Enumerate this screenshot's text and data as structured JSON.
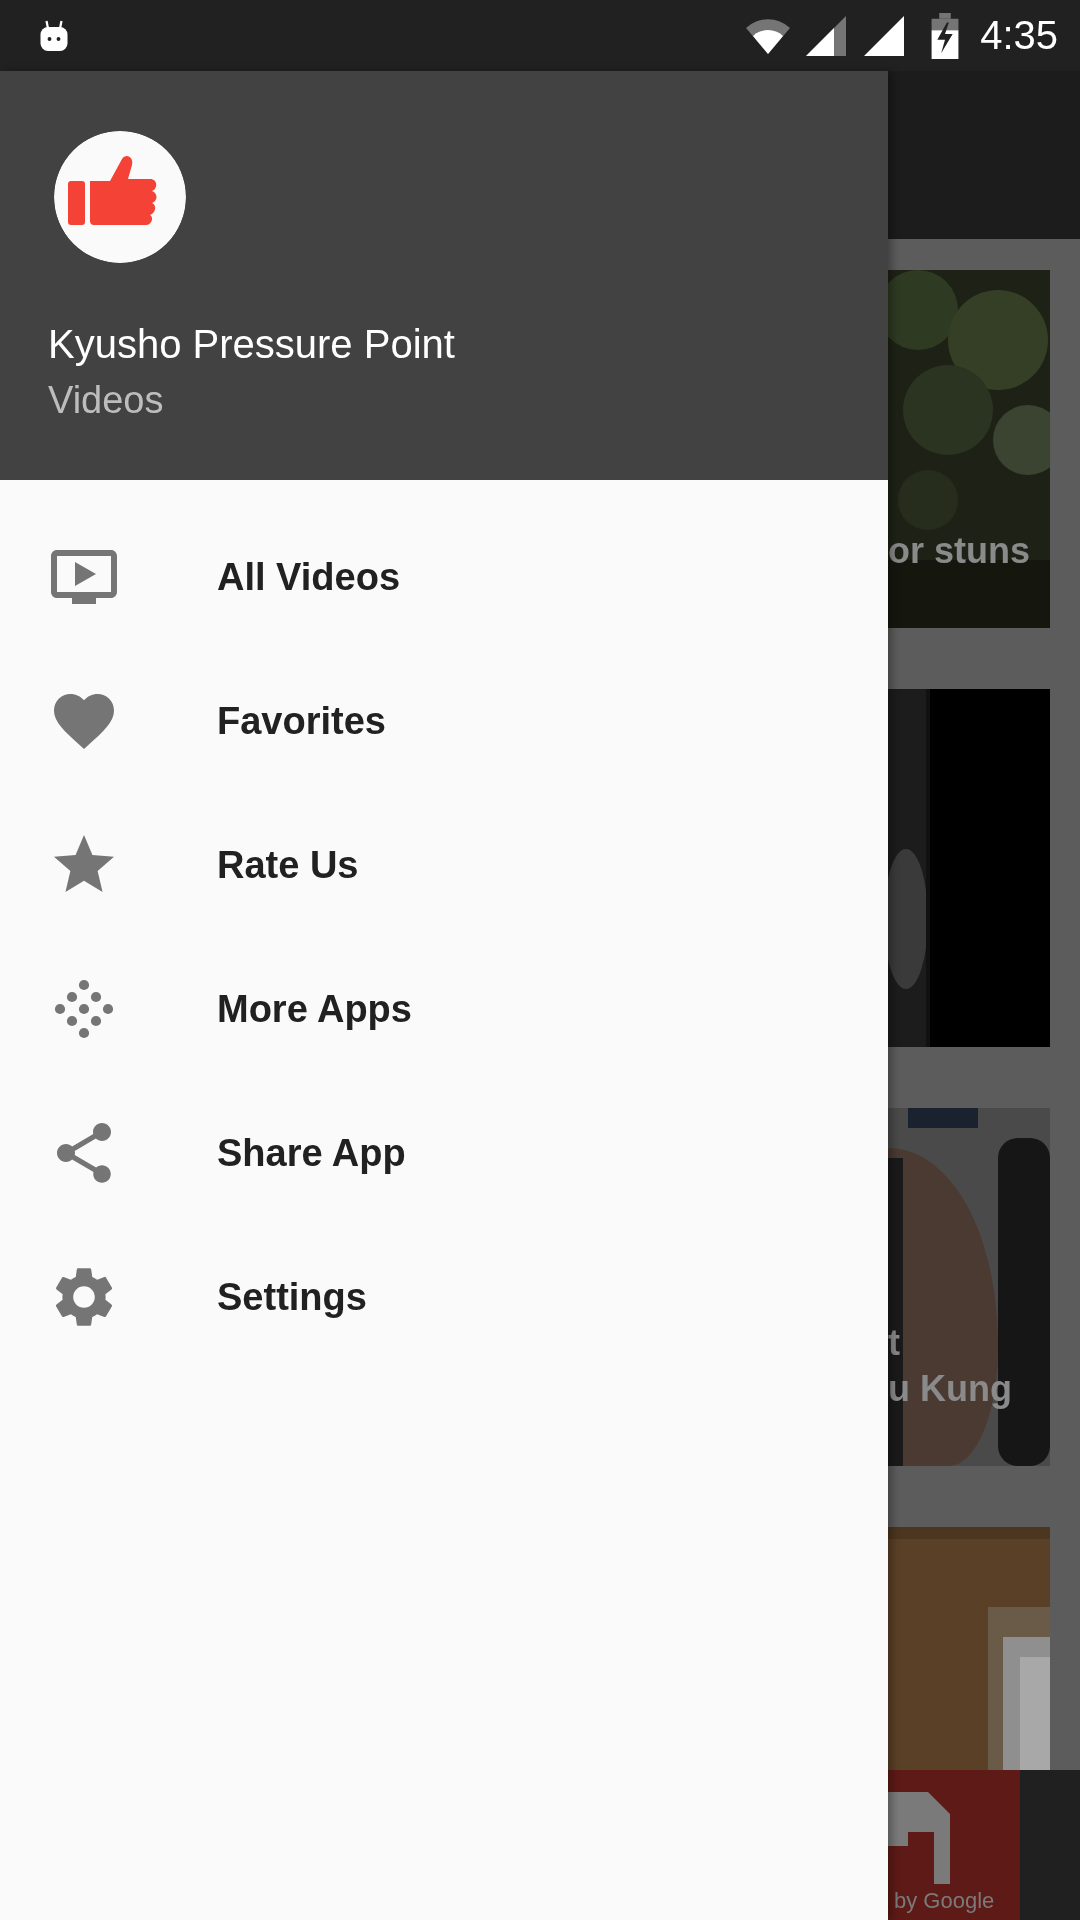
{
  "status_bar": {
    "time": "4:35"
  },
  "drawer": {
    "title": "Kyusho Pressure Point",
    "subtitle": "Videos",
    "items": [
      {
        "label": "All Videos",
        "kind": "videos"
      },
      {
        "label": "Favorites",
        "kind": "favorites"
      },
      {
        "label": "Rate Us",
        "kind": "rate"
      },
      {
        "label": "More Apps",
        "kind": "apps"
      },
      {
        "label": "Share App",
        "kind": "share"
      },
      {
        "label": "Settings",
        "kind": "settings"
      }
    ]
  },
  "video_list": {
    "cards": [
      {
        "kind": "foliage",
        "caption_lines": [
          "or stuns"
        ]
      },
      {
        "kind": "dark"
      },
      {
        "kind": "gym",
        "caption_lines": [
          "t",
          "u Kung"
        ]
      },
      {
        "kind": "room"
      }
    ]
  },
  "ad_banner": {
    "text": "by Google"
  }
}
